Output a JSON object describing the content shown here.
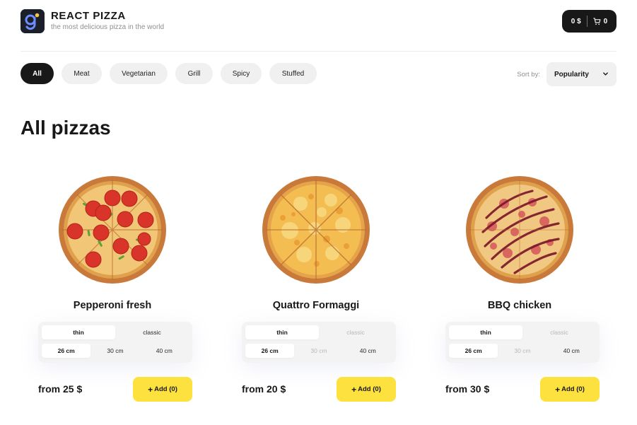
{
  "brand": {
    "title": "REACT PIZZA",
    "subtitle": "the most delicious pizza in the world",
    "logo_icon": "logo-icon"
  },
  "cart": {
    "price": "0 $",
    "count": "0",
    "icon": "cart-icon"
  },
  "categories": [
    {
      "label": "All",
      "active": true
    },
    {
      "label": "Meat",
      "active": false
    },
    {
      "label": "Vegetarian",
      "active": false
    },
    {
      "label": "Grill",
      "active": false
    },
    {
      "label": "Spicy",
      "active": false
    },
    {
      "label": "Stuffed",
      "active": false
    }
  ],
  "sort": {
    "label": "Sort by:",
    "value": "Popularity",
    "icon": "chevron-down-icon"
  },
  "page_title": "All pizzas",
  "pizzas": [
    {
      "name": "Pepperoni fresh",
      "image": "pepperoni-pizza-image",
      "doughs": [
        {
          "label": "thin",
          "state": "active"
        },
        {
          "label": "classic",
          "state": "enabled"
        }
      ],
      "sizes": [
        {
          "label": "26 cm",
          "state": "active"
        },
        {
          "label": "30 cm",
          "state": "enabled"
        },
        {
          "label": "40 cm",
          "state": "enabled"
        }
      ],
      "price": "from 25 $",
      "add_label": "Add (0)"
    },
    {
      "name": "Quattro Formaggi",
      "image": "cheese-pizza-image",
      "doughs": [
        {
          "label": "thin",
          "state": "active"
        },
        {
          "label": "classic",
          "state": "disabled"
        }
      ],
      "sizes": [
        {
          "label": "26 cm",
          "state": "active"
        },
        {
          "label": "30 cm",
          "state": "disabled"
        },
        {
          "label": "40 cm",
          "state": "enabled"
        }
      ],
      "price": "from 20 $",
      "add_label": "Add (0)"
    },
    {
      "name": "BBQ chicken",
      "image": "bbq-pizza-image",
      "doughs": [
        {
          "label": "thin",
          "state": "active"
        },
        {
          "label": "classic",
          "state": "disabled"
        }
      ],
      "sizes": [
        {
          "label": "26 cm",
          "state": "active"
        },
        {
          "label": "30 cm",
          "state": "disabled"
        },
        {
          "label": "40 cm",
          "state": "enabled"
        }
      ],
      "price": "from 30 $",
      "add_label": "Add (0)"
    }
  ],
  "colors": {
    "accent": "#fde13e",
    "dark": "#181818",
    "chip": "#f0f0f0"
  }
}
